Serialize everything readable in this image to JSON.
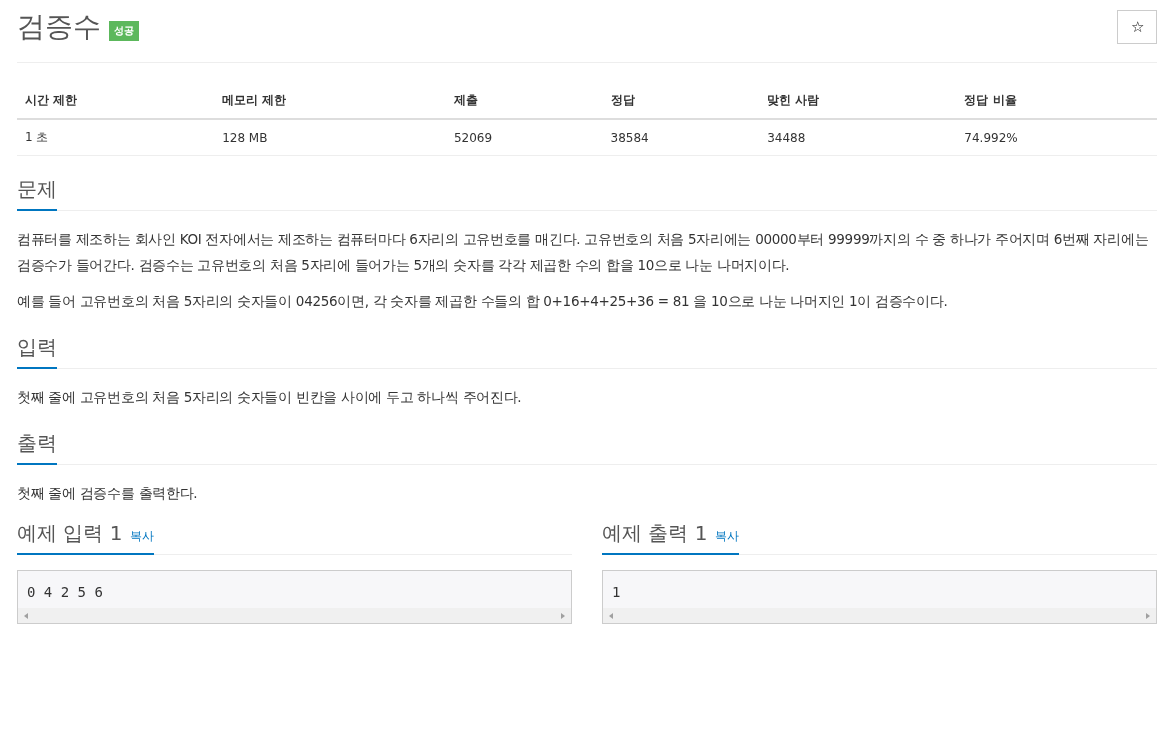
{
  "title": "검증수",
  "badge": "성공",
  "star_button": "☆",
  "stats": {
    "columns": [
      "시간 제한",
      "메모리 제한",
      "제출",
      "정답",
      "맞힌 사람",
      "정답 비율"
    ],
    "values": [
      "1 초",
      "128 MB",
      "52069",
      "38584",
      "34488",
      "74.992%"
    ]
  },
  "sections": [
    {
      "heading": "문제",
      "paragraphs": [
        "컴퓨터를 제조하는 회사인 KOI 전자에서는 제조하는 컴퓨터마다 6자리의 고유번호를 매긴다. 고유번호의 처음 5자리에는 00000부터 99999까지의 수 중 하나가 주어지며 6번째 자리에는 검증수가 들어간다. 검증수는 고유번호의 처음 5자리에 들어가는 5개의 숫자를 각각 제곱한 수의 합을 10으로 나눈 나머지이다.",
        "예를 들어 고유번호의 처음 5자리의 숫자들이 04256이면, 각 숫자를 제곱한 수들의 합 0+16+4+25+36 = 81 을 10으로 나눈 나머지인 1이 검증수이다."
      ]
    },
    {
      "heading": "입력",
      "paragraphs": [
        "첫째 줄에 고유번호의 처음 5자리의 숫자들이 빈칸을 사이에 두고 하나씩 주어진다."
      ]
    },
    {
      "heading": "출력",
      "paragraphs": [
        "첫째 줄에 검증수를 출력한다."
      ]
    }
  ],
  "samples": [
    {
      "heading": "예제 입력 1",
      "copy": "복사",
      "content": "0 4 2 5 6"
    },
    {
      "heading": "예제 출력 1",
      "copy": "복사",
      "content": "1"
    }
  ]
}
